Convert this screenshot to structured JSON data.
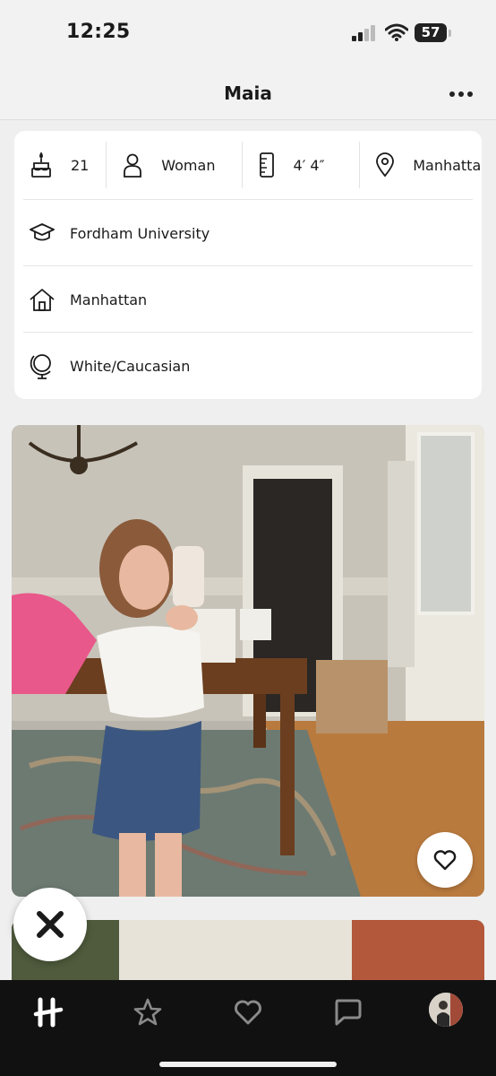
{
  "status_bar": {
    "time": "12:25",
    "battery": "57"
  },
  "header": {
    "title": "Maia",
    "more_icon": "ellipsis-icon"
  },
  "chips": [
    {
      "icon": "cake-icon",
      "label": "21"
    },
    {
      "icon": "person-icon",
      "label": "Woman"
    },
    {
      "icon": "ruler-icon",
      "label": "4′ 4″"
    },
    {
      "icon": "location-pin-icon",
      "label": "Manhattan"
    }
  ],
  "details": [
    {
      "icon": "graduation-cap-icon",
      "label": "Fordham University"
    },
    {
      "icon": "house-icon",
      "label": "Manhattan"
    },
    {
      "icon": "globe-icon",
      "label": "White/Caucasian"
    }
  ],
  "tabs": [
    {
      "icon": "hinge-logo-icon",
      "active": true
    },
    {
      "icon": "star-icon",
      "active": false
    },
    {
      "icon": "heart-icon",
      "active": false
    },
    {
      "icon": "chat-icon",
      "active": false
    },
    {
      "icon": "profile-avatar",
      "active": false
    }
  ],
  "colors": {
    "background": "#efefef",
    "card": "#ffffff",
    "tabbar": "#111111",
    "text": "#1a1a1a"
  }
}
